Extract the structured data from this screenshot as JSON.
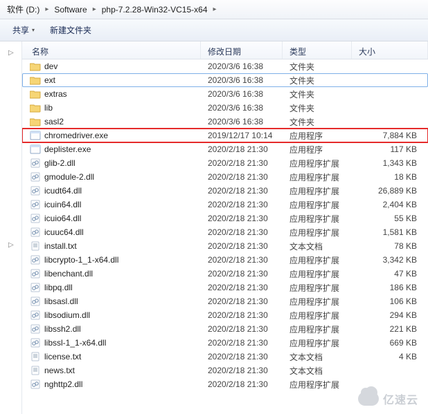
{
  "breadcrumb": {
    "drive": "软件 (D:)",
    "folder1": "Software",
    "folder2": "php-7.2.28-Win32-VC15-x64",
    "sep": "▸"
  },
  "toolbar": {
    "share": "共享",
    "newfolder": "新建文件夹",
    "drop": "▾"
  },
  "columns": {
    "name": "名称",
    "date": "修改日期",
    "type": "类型",
    "size": "大小"
  },
  "types": {
    "folder": "文件夹",
    "exe": "应用程序",
    "dll": "应用程序扩展",
    "txt": "文本文档"
  },
  "rows": [
    {
      "icon": "folder",
      "name": "dev",
      "date": "2020/3/6 16:38",
      "type": "folder",
      "size": ""
    },
    {
      "icon": "folder",
      "name": "ext",
      "date": "2020/3/6 16:38",
      "type": "folder",
      "size": "",
      "selected": true
    },
    {
      "icon": "folder",
      "name": "extras",
      "date": "2020/3/6 16:38",
      "type": "folder",
      "size": ""
    },
    {
      "icon": "folder",
      "name": "lib",
      "date": "2020/3/6 16:38",
      "type": "folder",
      "size": ""
    },
    {
      "icon": "folder",
      "name": "sasl2",
      "date": "2020/3/6 16:38",
      "type": "folder",
      "size": ""
    },
    {
      "icon": "exe",
      "name": "chromedriver.exe",
      "date": "2019/12/17 10:14",
      "type": "exe",
      "size": "7,884 KB",
      "highlight": true
    },
    {
      "icon": "exe",
      "name": "deplister.exe",
      "date": "2020/2/18 21:30",
      "type": "exe",
      "size": "117 KB"
    },
    {
      "icon": "dll",
      "name": "glib-2.dll",
      "date": "2020/2/18 21:30",
      "type": "dll",
      "size": "1,343 KB"
    },
    {
      "icon": "dll",
      "name": "gmodule-2.dll",
      "date": "2020/2/18 21:30",
      "type": "dll",
      "size": "18 KB"
    },
    {
      "icon": "dll",
      "name": "icudt64.dll",
      "date": "2020/2/18 21:30",
      "type": "dll",
      "size": "26,889 KB"
    },
    {
      "icon": "dll",
      "name": "icuin64.dll",
      "date": "2020/2/18 21:30",
      "type": "dll",
      "size": "2,404 KB"
    },
    {
      "icon": "dll",
      "name": "icuio64.dll",
      "date": "2020/2/18 21:30",
      "type": "dll",
      "size": "55 KB"
    },
    {
      "icon": "dll",
      "name": "icuuc64.dll",
      "date": "2020/2/18 21:30",
      "type": "dll",
      "size": "1,581 KB"
    },
    {
      "icon": "txt",
      "name": "install.txt",
      "date": "2020/2/18 21:30",
      "type": "txt",
      "size": "78 KB"
    },
    {
      "icon": "dll",
      "name": "libcrypto-1_1-x64.dll",
      "date": "2020/2/18 21:30",
      "type": "dll",
      "size": "3,342 KB"
    },
    {
      "icon": "dll",
      "name": "libenchant.dll",
      "date": "2020/2/18 21:30",
      "type": "dll",
      "size": "47 KB"
    },
    {
      "icon": "dll",
      "name": "libpq.dll",
      "date": "2020/2/18 21:30",
      "type": "dll",
      "size": "186 KB"
    },
    {
      "icon": "dll",
      "name": "libsasl.dll",
      "date": "2020/2/18 21:30",
      "type": "dll",
      "size": "106 KB"
    },
    {
      "icon": "dll",
      "name": "libsodium.dll",
      "date": "2020/2/18 21:30",
      "type": "dll",
      "size": "294 KB"
    },
    {
      "icon": "dll",
      "name": "libssh2.dll",
      "date": "2020/2/18 21:30",
      "type": "dll",
      "size": "221 KB"
    },
    {
      "icon": "dll",
      "name": "libssl-1_1-x64.dll",
      "date": "2020/2/18 21:30",
      "type": "dll",
      "size": "669 KB"
    },
    {
      "icon": "txt",
      "name": "license.txt",
      "date": "2020/2/18 21:30",
      "type": "txt",
      "size": "4 KB"
    },
    {
      "icon": "txt",
      "name": "news.txt",
      "date": "2020/2/18 21:30",
      "type": "txt",
      "size": ""
    },
    {
      "icon": "dll",
      "name": "nghttp2.dll",
      "date": "2020/2/18 21:30",
      "type": "dll",
      "size": ""
    }
  ],
  "watermark": {
    "text": "亿速云"
  }
}
